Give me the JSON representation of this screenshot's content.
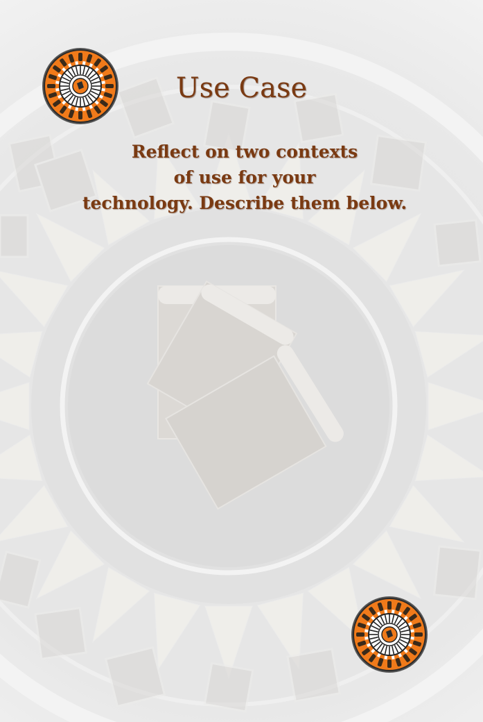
{
  "card": {
    "title": "Use Case",
    "description_lines": [
      "Reflect on two contexts",
      "of use for your",
      "technology. Describe them below."
    ]
  },
  "colors": {
    "title_text": "#7a3a12",
    "badge_orange": "#f07a1a",
    "badge_dark": "#2b2b2b",
    "background": "#e4e4e4"
  },
  "icons": [
    "book-medallion-icon",
    "book-medallion-icon",
    "books-stack-icon"
  ]
}
